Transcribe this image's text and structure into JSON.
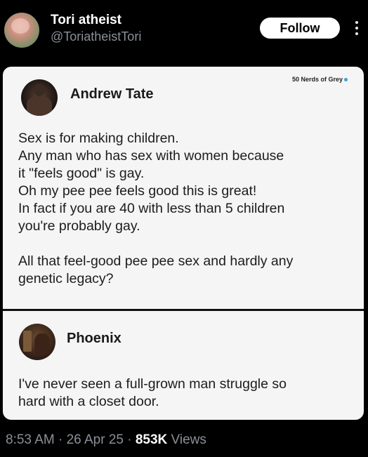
{
  "author": {
    "display_name": "Tori atheist",
    "handle": "@ToriatheistTori"
  },
  "actions": {
    "follow_label": "Follow",
    "more_icon": "more-vertical-icon"
  },
  "card": {
    "watermark": "50 Nerds of Grey",
    "watermark_dot_color": "#39a0d8",
    "post1": {
      "name": "Andrew Tate",
      "lines_a": [
        "Sex is for making children.",
        "Any man who has sex with women because",
        "it \"feels good\" is gay.",
        "Oh my pee pee feels good this is great!",
        "In fact if you are 40 with less than 5 children",
        "you're probably gay."
      ],
      "lines_b": [
        "All that feel-good pee pee sex and hardly any",
        "genetic legacy?"
      ]
    },
    "post2": {
      "name": "Phoenix",
      "lines": [
        "I've never seen a full-grown man struggle so",
        "hard with a closet door."
      ]
    }
  },
  "meta": {
    "time": "8:53 AM",
    "sep1": " · ",
    "date": "26 Apr 25",
    "sep2": " · ",
    "views_count": "853K",
    "views_label": " Views"
  }
}
